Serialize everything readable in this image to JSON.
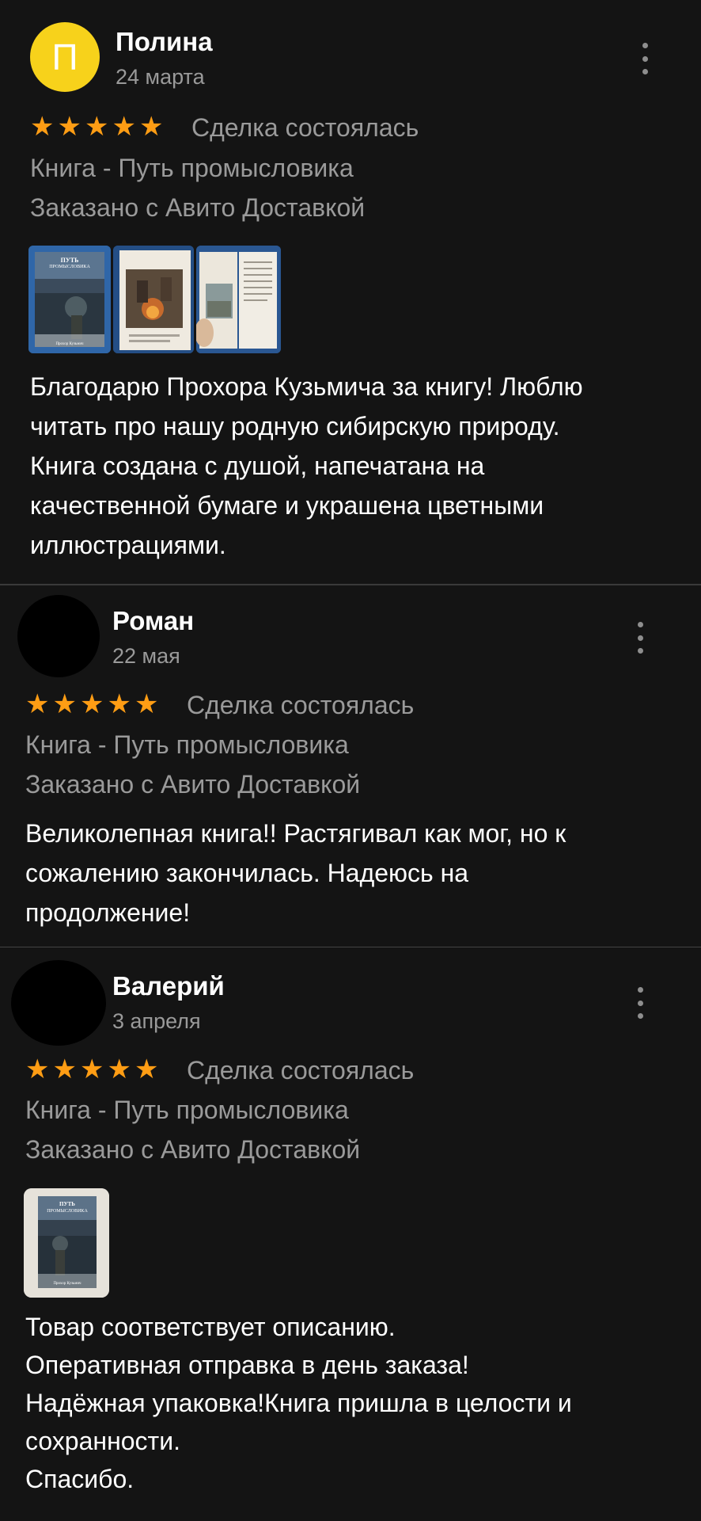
{
  "reviews": [
    {
      "avatar_letter": "П",
      "name": "Полина",
      "date": "24 марта",
      "rating": 5,
      "status": "Сделка состоялась",
      "item": "Книга - Путь промысловика",
      "delivery": "Заказано с Авито Доставкой",
      "text": "Благодарю Прохора Кузьмича за книгу! Люблю\nчитать про нашу родную сибирскую природу.\nКнига создана с душой, напечатана на\nкачественной бумаге и украшена цветными\nиллюстрациями."
    },
    {
      "avatar_letter": "",
      "name": "Роман",
      "date": "22 мая",
      "rating": 5,
      "status": "Сделка состоялась",
      "item": "Книга - Путь промысловика",
      "delivery": "Заказано с Авито Доставкой",
      "text": "Великолепная книга!! Растягивал как мог, но к\nсожалению закончилась. Надеюсь на\nпродолжение!"
    },
    {
      "avatar_letter": "",
      "name": "Валерий",
      "date": "3 апреля",
      "rating": 5,
      "status": "Сделка состоялась",
      "item": "Книга - Путь промысловика",
      "delivery": "Заказано с Авито Доставкой",
      "text": "Товар соответствует описанию.\nОперативная отправка в день заказа!\nНадёжная упаковка!Книга пришла в целости и\nсохранности.\nСпасибо."
    }
  ],
  "book_cover": {
    "title_line1": "ПУТЬ",
    "title_line2": "ПРОМЫСЛОВИКА",
    "author": "Прохор Кузьмич"
  },
  "colors": {
    "background": "#141414",
    "star": "#ff9d14",
    "avatar_yellow": "#f7d21b",
    "secondary_text": "#9a9a9a"
  }
}
